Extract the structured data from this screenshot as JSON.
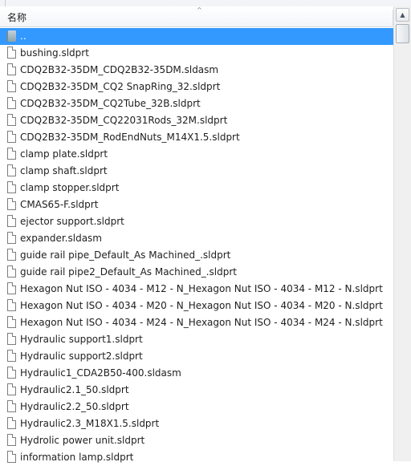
{
  "header": {
    "column_name": "名称",
    "sort_indicator": "^"
  },
  "scrollbar": {
    "up_arrow": "▲"
  },
  "files": [
    {
      "name": "..",
      "type": "parent-folder",
      "selected": true
    },
    {
      "name": "bushing.sldprt",
      "type": "file"
    },
    {
      "name": "CDQ2B32-35DM_CDQ2B32-35DM.sldasm",
      "type": "file"
    },
    {
      "name": "CDQ2B32-35DM_CQ2 SnapRing_32.sldprt",
      "type": "file"
    },
    {
      "name": "CDQ2B32-35DM_CQ2Tube_32B.sldprt",
      "type": "file"
    },
    {
      "name": "CDQ2B32-35DM_CQ22031Rods_32M.sldprt",
      "type": "file"
    },
    {
      "name": "CDQ2B32-35DM_RodEndNuts_M14X1.5.sldprt",
      "type": "file"
    },
    {
      "name": "clamp plate.sldprt",
      "type": "file"
    },
    {
      "name": "clamp shaft.sldprt",
      "type": "file"
    },
    {
      "name": "clamp stopper.sldprt",
      "type": "file"
    },
    {
      "name": "CMAS65-F.sldprt",
      "type": "file"
    },
    {
      "name": "ejector support.sldprt",
      "type": "file"
    },
    {
      "name": "expander.sldasm",
      "type": "file"
    },
    {
      "name": "guide rail pipe_Default_As Machined_.sldprt",
      "type": "file"
    },
    {
      "name": "guide rail pipe2_Default_As Machined_.sldprt",
      "type": "file"
    },
    {
      "name": "Hexagon Nut ISO - 4034 - M12 - N_Hexagon Nut ISO - 4034 - M12 - N.sldprt",
      "type": "file"
    },
    {
      "name": "Hexagon Nut ISO - 4034 - M20 - N_Hexagon Nut ISO - 4034 - M20 - N.sldprt",
      "type": "file"
    },
    {
      "name": "Hexagon Nut ISO - 4034 - M24 - N_Hexagon Nut ISO - 4034 - M24 - N.sldprt",
      "type": "file"
    },
    {
      "name": "Hydraulic support1.sldprt",
      "type": "file"
    },
    {
      "name": "Hydraulic support2.sldprt",
      "type": "file"
    },
    {
      "name": "Hydraulic1_CDA2B50-400.sldasm",
      "type": "file"
    },
    {
      "name": "Hydraulic2.1_50.sldprt",
      "type": "file"
    },
    {
      "name": "Hydraulic2.2_50.sldprt",
      "type": "file"
    },
    {
      "name": "Hydraulic2.3_M18X1.5.sldprt",
      "type": "file"
    },
    {
      "name": "Hydrolic power unit.sldprt",
      "type": "file"
    },
    {
      "name": "information lamp.sldprt",
      "type": "file"
    }
  ]
}
